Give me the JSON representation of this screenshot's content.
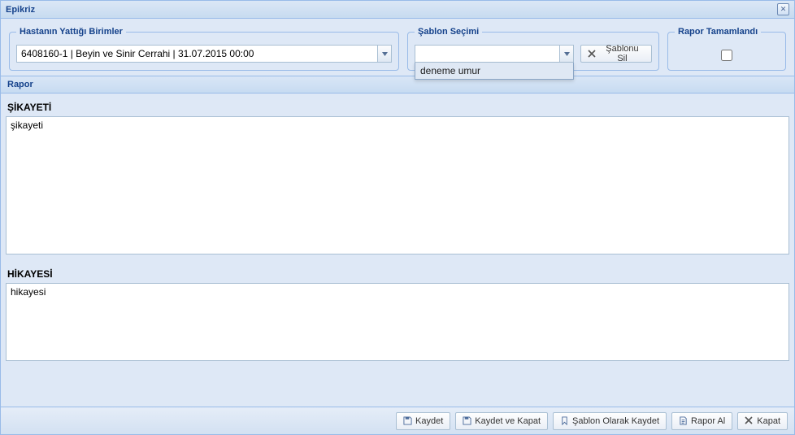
{
  "window": {
    "title": "Epikriz"
  },
  "fieldsets": {
    "units": {
      "legend": "Hastanın Yattığı Birimler",
      "selected": "6408160-1 | Beyin ve Sinir Cerrahi | 31.07.2015 00:00"
    },
    "template": {
      "legend": "Şablon Seçimi",
      "selected": "",
      "delete_label": "Şablonu Sil",
      "options": [
        "deneme umur"
      ]
    },
    "done": {
      "legend": "Rapor Tamamlandı",
      "checked": false
    }
  },
  "rapor": {
    "header": "Rapor",
    "sections": [
      {
        "label": "ŞİKAYETİ",
        "value": "şikayeti"
      },
      {
        "label": "HİKAYESİ",
        "value": "hikayesi"
      }
    ]
  },
  "footer": {
    "save": "Kaydet",
    "save_close": "Kaydet ve Kapat",
    "save_template": "Şablon Olarak Kaydet",
    "report": "Rapor Al",
    "close": "Kapat"
  },
  "icons": {
    "close_x": "✕",
    "x": "✕"
  }
}
